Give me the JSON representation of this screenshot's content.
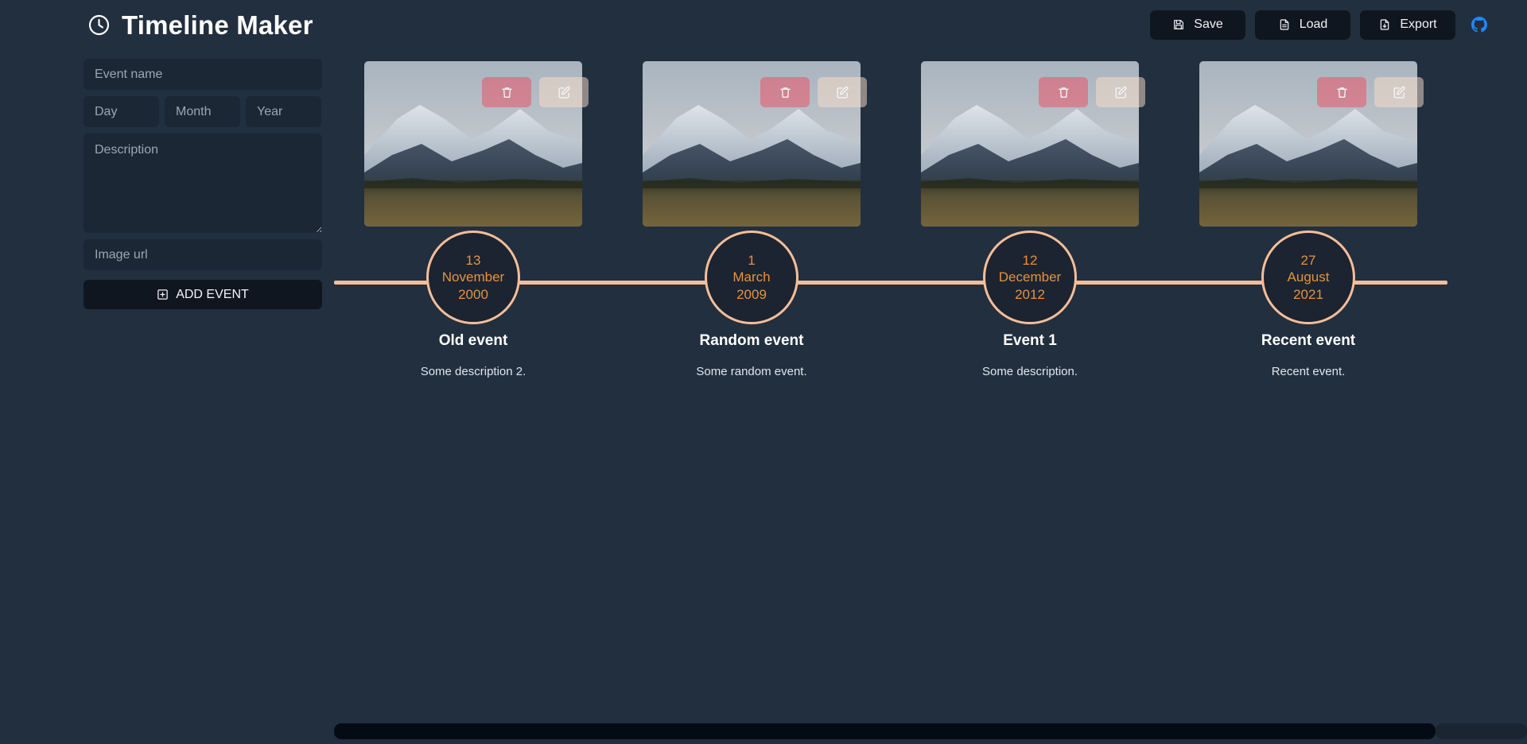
{
  "header": {
    "title": "Timeline Maker",
    "clock_icon": "clock-icon",
    "buttons": [
      {
        "label": "Save",
        "icon": "floppy-disk-icon"
      },
      {
        "label": "Load",
        "icon": "document-icon"
      },
      {
        "label": "Export",
        "icon": "document-export-icon"
      }
    ],
    "github_icon": "github-icon"
  },
  "form": {
    "event_name_placeholder": "Event name",
    "day_placeholder": "Day",
    "month_placeholder": "Month",
    "year_placeholder": "Year",
    "description_placeholder": "Description",
    "image_url_placeholder": "Image url",
    "event_name_value": "",
    "day_value": "",
    "month_value": "",
    "year_value": "",
    "description_value": "",
    "image_url_value": "",
    "add_button_label": "ADD EVENT",
    "add_button_icon": "plus-square-icon"
  },
  "timeline": {
    "delete_icon": "trash-icon",
    "edit_icon": "pencil-square-icon",
    "events": [
      {
        "day": "13",
        "month": "November",
        "year": "2000",
        "title": "Old event",
        "description": "Some description 2.",
        "image_alt": "snowy-mountain-landscape"
      },
      {
        "day": "1",
        "month": "March",
        "year": "2009",
        "title": "Random event",
        "description": "Some random event.",
        "image_alt": "snowy-mountain-landscape"
      },
      {
        "day": "12",
        "month": "December",
        "year": "2012",
        "title": "Event 1",
        "description": "Some description.",
        "image_alt": "snowy-mountain-landscape"
      },
      {
        "day": "27",
        "month": "August",
        "year": "2021",
        "title": "Recent event",
        "description": "Recent event.",
        "image_alt": "snowy-mountain-landscape"
      }
    ]
  },
  "colors": {
    "background": "#222f3e",
    "panel": "#1b2735",
    "button": "#0f1620",
    "accent_line": "#f8bd99",
    "date_text": "#e8913f",
    "github": "#2188ff",
    "delete": "#e95467",
    "edit": "#f8dcc7"
  }
}
